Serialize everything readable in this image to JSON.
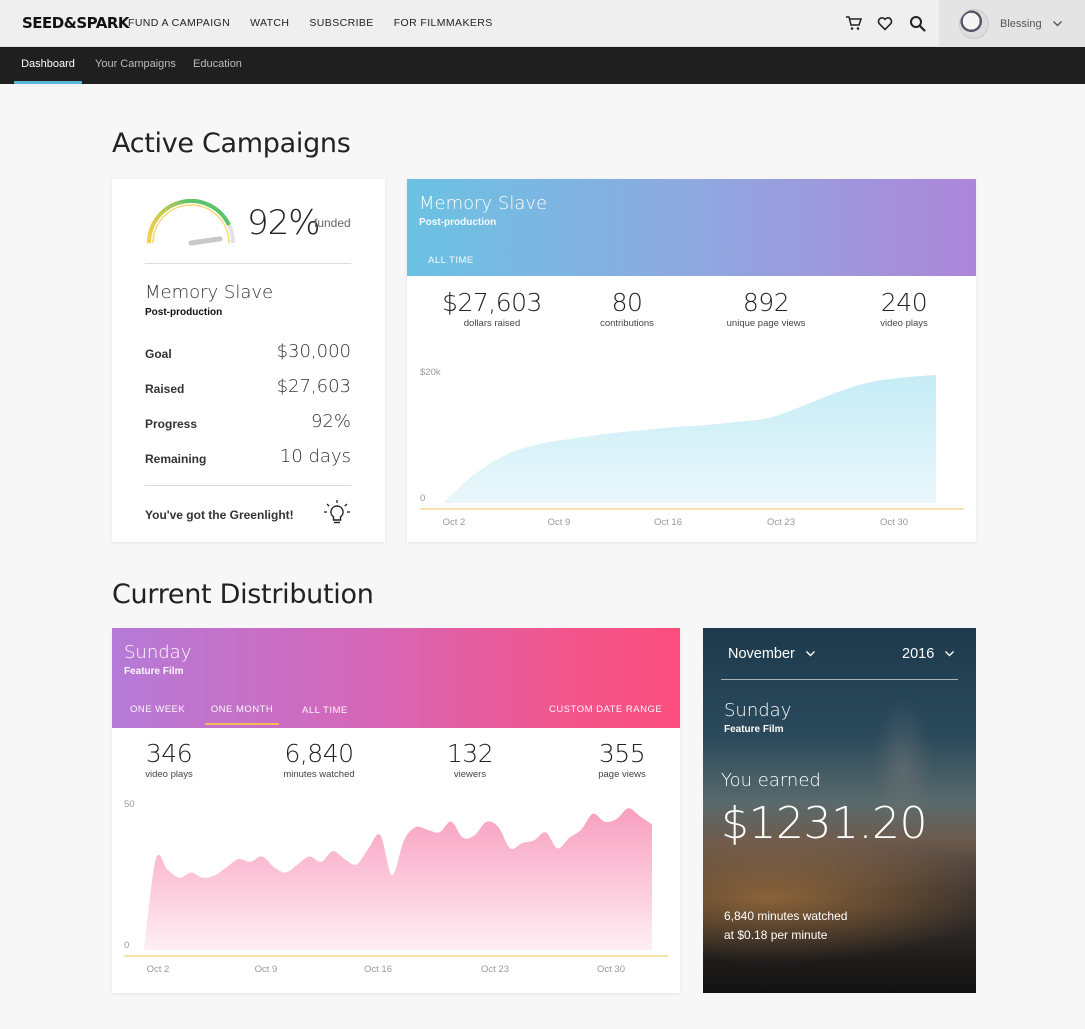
{
  "topnav": {
    "logo": "SEED&SPARK",
    "links": [
      "FUND A CAMPAIGN",
      "WATCH",
      "SUBSCRIBE",
      "FOR FILMMAKERS"
    ],
    "icons": [
      "cart-icon",
      "heart-icon",
      "search-icon"
    ],
    "user": "Blessing"
  },
  "subnav": {
    "tabs": [
      "Dashboard",
      "Your Campaigns",
      "Education"
    ],
    "active": "Dashboard"
  },
  "active_campaigns": {
    "heading": "Active Campaigns",
    "summary": {
      "percent": "92%",
      "funded_label": "funded",
      "title": "Memory Slave",
      "stage": "Post-production",
      "stats": [
        {
          "label": "Goal",
          "value": "$30,000"
        },
        {
          "label": "Raised",
          "value": "$27,603"
        },
        {
          "label": "Progress",
          "value": "92%"
        },
        {
          "label": "Remaining",
          "value": "10 days"
        }
      ],
      "greenlight": "You've got the Greenlight!",
      "gauge_fraction": 0.92
    },
    "detail": {
      "title": "Memory Slave",
      "stage": "Post-production",
      "tab": "ALL TIME",
      "metrics": [
        {
          "value": "$27,603",
          "label": "dollars raised"
        },
        {
          "value": "80",
          "label": "contributions"
        },
        {
          "value": "892",
          "label": "unique page views"
        },
        {
          "value": "240",
          "label": "video plays"
        }
      ]
    }
  },
  "distribution": {
    "heading": "Current Distribution",
    "detail": {
      "title": "Sunday",
      "stage": "Feature Film",
      "tabs": [
        "ONE WEEK",
        "ONE MONTH",
        "ALL TIME"
      ],
      "selected_tab": "ONE MONTH",
      "custom_range": "CUSTOM DATE RANGE",
      "metrics": [
        {
          "value": "346",
          "label": "video plays"
        },
        {
          "value": "6,840",
          "label": "minutes watched"
        },
        {
          "value": "132",
          "label": "viewers"
        },
        {
          "value": "355",
          "label": "page views"
        }
      ]
    },
    "earnings": {
      "month": "November",
      "year": "2016",
      "title": "Sunday",
      "stage": "Feature Film",
      "earned_label": "You earned",
      "amount": "$1231.20",
      "note_line1": "6,840 minutes watched",
      "note_line2": "at $0.18 per minute"
    }
  },
  "chart_data": [
    {
      "type": "area",
      "x": [
        "Oct 1",
        "Oct 3",
        "Oct 5",
        "Oct 7",
        "Oct 9",
        "Oct 11",
        "Oct 13",
        "Oct 15",
        "Oct 17",
        "Oct 19",
        "Oct 21",
        "Oct 23",
        "Oct 25",
        "Oct 27",
        "Oct 29",
        "Oct 31"
      ],
      "series": [
        {
          "values": [
            0,
            4500,
            7500,
            9000,
            9800,
            10500,
            11000,
            11500,
            11800,
            12300,
            13000,
            14800,
            16800,
            18300,
            19000,
            19400
          ]
        }
      ],
      "xticks": [
        "Oct 2",
        "Oct 9",
        "Oct 16",
        "Oct 23",
        "Oct 30"
      ],
      "yticks": [
        "$20k",
        "0"
      ],
      "ylim": [
        0,
        20000
      ],
      "color": "#cdeef6"
    },
    {
      "type": "area",
      "x": [
        1,
        2,
        3,
        4,
        5,
        6,
        7,
        8,
        9,
        10,
        11,
        12,
        13,
        14,
        15,
        16,
        17,
        18,
        19,
        20,
        21,
        22,
        23,
        24,
        25,
        26,
        27,
        28,
        29,
        30,
        31,
        32,
        33,
        34,
        35,
        36,
        37,
        38,
        39,
        40,
        41,
        42,
        43,
        44
      ],
      "series": [
        {
          "values": [
            0,
            34,
            30,
            27,
            29,
            27,
            28,
            31,
            34,
            33,
            35,
            31,
            29,
            32,
            35,
            33,
            37,
            34,
            32,
            38,
            43,
            28,
            41,
            46,
            45,
            44,
            48,
            42,
            43,
            48,
            46,
            38,
            40,
            41,
            44,
            38,
            42,
            45,
            51,
            48,
            49,
            53,
            50,
            47
          ]
        }
      ],
      "xticks": [
        "Oct 2",
        "Oct 9",
        "Oct 16",
        "Oct 23",
        "Oct 30"
      ],
      "yticks": [
        "50",
        "0"
      ],
      "ylim": [
        0,
        55
      ],
      "color": "#f7a8c4"
    }
  ]
}
